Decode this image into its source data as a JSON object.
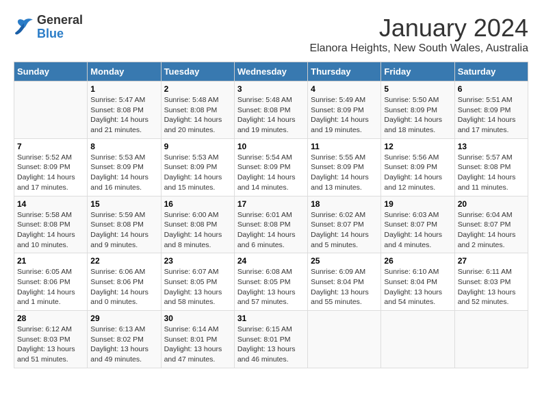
{
  "header": {
    "logo_line1": "General",
    "logo_line2": "Blue",
    "month": "January 2024",
    "location": "Elanora Heights, New South Wales, Australia"
  },
  "days_of_week": [
    "Sunday",
    "Monday",
    "Tuesday",
    "Wednesday",
    "Thursday",
    "Friday",
    "Saturday"
  ],
  "weeks": [
    [
      {
        "day": "",
        "info": ""
      },
      {
        "day": "1",
        "info": "Sunrise: 5:47 AM\nSunset: 8:08 PM\nDaylight: 14 hours\nand 21 minutes."
      },
      {
        "day": "2",
        "info": "Sunrise: 5:48 AM\nSunset: 8:08 PM\nDaylight: 14 hours\nand 20 minutes."
      },
      {
        "day": "3",
        "info": "Sunrise: 5:48 AM\nSunset: 8:08 PM\nDaylight: 14 hours\nand 19 minutes."
      },
      {
        "day": "4",
        "info": "Sunrise: 5:49 AM\nSunset: 8:09 PM\nDaylight: 14 hours\nand 19 minutes."
      },
      {
        "day": "5",
        "info": "Sunrise: 5:50 AM\nSunset: 8:09 PM\nDaylight: 14 hours\nand 18 minutes."
      },
      {
        "day": "6",
        "info": "Sunrise: 5:51 AM\nSunset: 8:09 PM\nDaylight: 14 hours\nand 17 minutes."
      }
    ],
    [
      {
        "day": "7",
        "info": "Sunrise: 5:52 AM\nSunset: 8:09 PM\nDaylight: 14 hours\nand 17 minutes."
      },
      {
        "day": "8",
        "info": "Sunrise: 5:53 AM\nSunset: 8:09 PM\nDaylight: 14 hours\nand 16 minutes."
      },
      {
        "day": "9",
        "info": "Sunrise: 5:53 AM\nSunset: 8:09 PM\nDaylight: 14 hours\nand 15 minutes."
      },
      {
        "day": "10",
        "info": "Sunrise: 5:54 AM\nSunset: 8:09 PM\nDaylight: 14 hours\nand 14 minutes."
      },
      {
        "day": "11",
        "info": "Sunrise: 5:55 AM\nSunset: 8:09 PM\nDaylight: 14 hours\nand 13 minutes."
      },
      {
        "day": "12",
        "info": "Sunrise: 5:56 AM\nSunset: 8:09 PM\nDaylight: 14 hours\nand 12 minutes."
      },
      {
        "day": "13",
        "info": "Sunrise: 5:57 AM\nSunset: 8:08 PM\nDaylight: 14 hours\nand 11 minutes."
      }
    ],
    [
      {
        "day": "14",
        "info": "Sunrise: 5:58 AM\nSunset: 8:08 PM\nDaylight: 14 hours\nand 10 minutes."
      },
      {
        "day": "15",
        "info": "Sunrise: 5:59 AM\nSunset: 8:08 PM\nDaylight: 14 hours\nand 9 minutes."
      },
      {
        "day": "16",
        "info": "Sunrise: 6:00 AM\nSunset: 8:08 PM\nDaylight: 14 hours\nand 8 minutes."
      },
      {
        "day": "17",
        "info": "Sunrise: 6:01 AM\nSunset: 8:08 PM\nDaylight: 14 hours\nand 6 minutes."
      },
      {
        "day": "18",
        "info": "Sunrise: 6:02 AM\nSunset: 8:07 PM\nDaylight: 14 hours\nand 5 minutes."
      },
      {
        "day": "19",
        "info": "Sunrise: 6:03 AM\nSunset: 8:07 PM\nDaylight: 14 hours\nand 4 minutes."
      },
      {
        "day": "20",
        "info": "Sunrise: 6:04 AM\nSunset: 8:07 PM\nDaylight: 14 hours\nand 2 minutes."
      }
    ],
    [
      {
        "day": "21",
        "info": "Sunrise: 6:05 AM\nSunset: 8:06 PM\nDaylight: 14 hours\nand 1 minute."
      },
      {
        "day": "22",
        "info": "Sunrise: 6:06 AM\nSunset: 8:06 PM\nDaylight: 14 hours\nand 0 minutes."
      },
      {
        "day": "23",
        "info": "Sunrise: 6:07 AM\nSunset: 8:05 PM\nDaylight: 13 hours\nand 58 minutes."
      },
      {
        "day": "24",
        "info": "Sunrise: 6:08 AM\nSunset: 8:05 PM\nDaylight: 13 hours\nand 57 minutes."
      },
      {
        "day": "25",
        "info": "Sunrise: 6:09 AM\nSunset: 8:04 PM\nDaylight: 13 hours\nand 55 minutes."
      },
      {
        "day": "26",
        "info": "Sunrise: 6:10 AM\nSunset: 8:04 PM\nDaylight: 13 hours\nand 54 minutes."
      },
      {
        "day": "27",
        "info": "Sunrise: 6:11 AM\nSunset: 8:03 PM\nDaylight: 13 hours\nand 52 minutes."
      }
    ],
    [
      {
        "day": "28",
        "info": "Sunrise: 6:12 AM\nSunset: 8:03 PM\nDaylight: 13 hours\nand 51 minutes."
      },
      {
        "day": "29",
        "info": "Sunrise: 6:13 AM\nSunset: 8:02 PM\nDaylight: 13 hours\nand 49 minutes."
      },
      {
        "day": "30",
        "info": "Sunrise: 6:14 AM\nSunset: 8:01 PM\nDaylight: 13 hours\nand 47 minutes."
      },
      {
        "day": "31",
        "info": "Sunrise: 6:15 AM\nSunset: 8:01 PM\nDaylight: 13 hours\nand 46 minutes."
      },
      {
        "day": "",
        "info": ""
      },
      {
        "day": "",
        "info": ""
      },
      {
        "day": "",
        "info": ""
      }
    ]
  ]
}
